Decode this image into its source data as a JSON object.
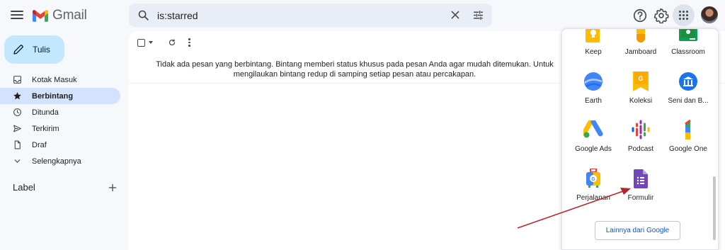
{
  "header": {
    "logo_text": "Gmail",
    "search_value": "is:starred"
  },
  "sidebar": {
    "compose_label": "Tulis",
    "items": [
      {
        "label": "Kotak Masuk",
        "icon": "inbox-icon"
      },
      {
        "label": "Berbintang",
        "icon": "star-icon",
        "active": true
      },
      {
        "label": "Ditunda",
        "icon": "clock-icon"
      },
      {
        "label": "Terkirim",
        "icon": "send-icon"
      },
      {
        "label": "Draf",
        "icon": "draft-icon"
      },
      {
        "label": "Selengkapnya",
        "icon": "chevron-down-icon"
      }
    ],
    "labels_heading": "Label"
  },
  "main": {
    "empty_message": "Tidak ada pesan yang berbintang. Bintang memberi status khusus pada pesan Anda agar mudah ditemukan. Untuk mengilaukan bintang redup di samping setiap pesan atau percakapan."
  },
  "apps_panel": {
    "apps": [
      {
        "label": "Keep",
        "icon": "keep-icon"
      },
      {
        "label": "Jamboard",
        "icon": "jamboard-icon"
      },
      {
        "label": "Classroom",
        "icon": "classroom-icon"
      },
      {
        "label": "Earth",
        "icon": "earth-icon"
      },
      {
        "label": "Koleksi",
        "icon": "collections-icon"
      },
      {
        "label": "Seni dan B...",
        "icon": "arts-culture-icon"
      },
      {
        "label": "Google Ads",
        "icon": "google-ads-icon"
      },
      {
        "label": "Podcast",
        "icon": "podcasts-icon"
      },
      {
        "label": "Google One",
        "icon": "google-one-icon"
      },
      {
        "label": "Perjalanan",
        "icon": "travel-icon"
      },
      {
        "label": "Formulir",
        "icon": "forms-icon"
      }
    ],
    "more_button": "Lainnya dari Google"
  },
  "colors": {
    "accent": "#0b57d0",
    "compose_bg": "#c2e7ff",
    "active_nav": "#d3e3fd",
    "annotation_arrow": "#b3262d"
  }
}
